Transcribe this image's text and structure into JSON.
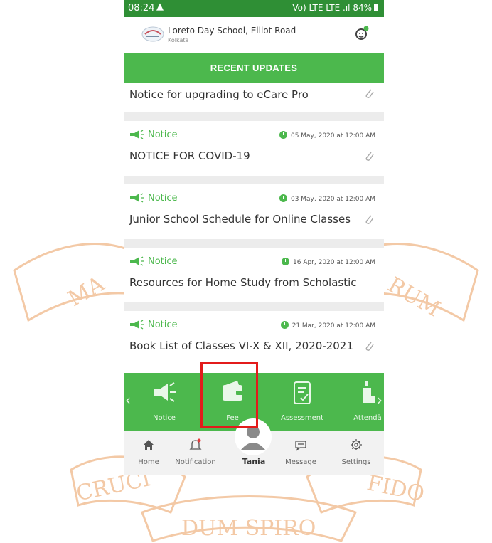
{
  "status_bar": {
    "time": "08:24",
    "warning_icon": "warning-triangle-icon",
    "signal_labels": "Vo) LTE LTE .ıl",
    "battery": "84%"
  },
  "school": {
    "name": "Loreto Day School, Elliot Road",
    "city": "Kolkata"
  },
  "section_title": "RECENT UPDATES",
  "feed": {
    "items": [
      {
        "tag": "",
        "date": "",
        "title": "Notice for upgrading to eCare Pro"
      },
      {
        "tag": "Notice",
        "date": "05 May, 2020 at 12:00 AM",
        "title": "NOTICE FOR COVID-19"
      },
      {
        "tag": "Notice",
        "date": "03 May, 2020 at 12:00 AM",
        "title": "Junior School Schedule for Online Classes"
      },
      {
        "tag": "Notice",
        "date": "16 Apr, 2020 at 12:00 AM",
        "title": "Resources for Home Study from Scholastic"
      },
      {
        "tag": "Notice",
        "date": "21 Mar, 2020 at 12:00 AM",
        "title": "Book List of Classes VI-X & XII, 2020-2021"
      }
    ]
  },
  "menu": {
    "items": [
      {
        "label": "Notice",
        "icon": "megaphone-icon"
      },
      {
        "label": "Fee",
        "icon": "wallet-icon"
      },
      {
        "label": "Assessment",
        "icon": "clipboard-check-icon"
      },
      {
        "label": "Attendā",
        "icon": "attendance-icon"
      }
    ]
  },
  "bottom_nav": {
    "home": "Home",
    "notification": "Notification",
    "user": "Tania",
    "message": "Message",
    "settings": "Settings"
  },
  "watermark": {
    "words": [
      "MA",
      "RUM",
      "CRUCI",
      "FIDO",
      "DUM SPIRO"
    ]
  },
  "colors": {
    "status_bar": "#2f8f35",
    "accent_green": "#4cb84d",
    "highlight_box": "#e31b1b",
    "watermark": "#f3c9a6"
  }
}
